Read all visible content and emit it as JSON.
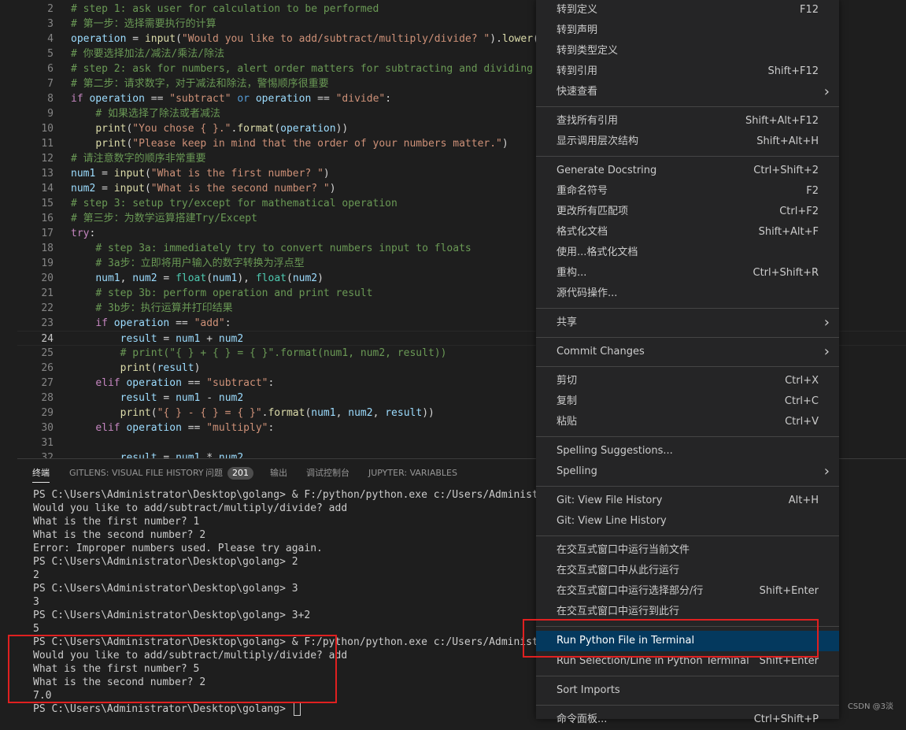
{
  "editor": {
    "lines": [
      {
        "num": "2",
        "tokens": [
          [
            "c",
            "# step 1: ask user for calculation to be performed"
          ]
        ]
      },
      {
        "num": "3",
        "tokens": [
          [
            "c",
            "# 第一步：选择需要执行的计算"
          ]
        ]
      },
      {
        "num": "4",
        "tokens": [
          [
            "v",
            "operation"
          ],
          [
            "o",
            " = "
          ],
          [
            "f",
            "input"
          ],
          [
            "o",
            "("
          ],
          [
            "s",
            "\"Would you like to add/subtract/multiply/divide? \""
          ],
          [
            "o",
            ")."
          ],
          [
            "f",
            "lower"
          ],
          [
            "o",
            "()"
          ]
        ]
      },
      {
        "num": "5",
        "tokens": [
          [
            "c",
            "# 你要选择加法/减法/乘法/除法"
          ]
        ]
      },
      {
        "num": "6",
        "tokens": [
          [
            "c",
            "# step 2: ask for numbers, alert order matters for subtracting and dividing"
          ]
        ]
      },
      {
        "num": "7",
        "tokens": [
          [
            "c",
            "# 第二步：请求数字，对于减法和除法，警惕顺序很重要"
          ]
        ]
      },
      {
        "num": "8",
        "tokens": [
          [
            "k",
            "if"
          ],
          [
            "o",
            " "
          ],
          [
            "v",
            "operation"
          ],
          [
            "o",
            " == "
          ],
          [
            "s",
            "\"subtract\""
          ],
          [
            "o",
            " "
          ],
          [
            "kb",
            "or"
          ],
          [
            "o",
            " "
          ],
          [
            "v",
            "operation"
          ],
          [
            "o",
            " == "
          ],
          [
            "s",
            "\"divide\""
          ],
          [
            "o",
            ":"
          ]
        ]
      },
      {
        "num": "9",
        "tokens": [
          [
            "o",
            "    "
          ],
          [
            "c",
            "# 如果选择了除法或者减法"
          ]
        ]
      },
      {
        "num": "10",
        "tokens": [
          [
            "o",
            "    "
          ],
          [
            "f",
            "print"
          ],
          [
            "o",
            "("
          ],
          [
            "s",
            "\"You chose { }.\""
          ],
          [
            "o",
            "."
          ],
          [
            "f",
            "format"
          ],
          [
            "o",
            "("
          ],
          [
            "v",
            "operation"
          ],
          [
            "o",
            "))"
          ]
        ]
      },
      {
        "num": "11",
        "tokens": [
          [
            "o",
            "    "
          ],
          [
            "f",
            "print"
          ],
          [
            "o",
            "("
          ],
          [
            "s",
            "\"Please keep in mind that the order of your numbers matter.\""
          ],
          [
            "o",
            ")"
          ]
        ]
      },
      {
        "num": "12",
        "tokens": [
          [
            "c",
            "# 请注意数字的顺序非常重要"
          ]
        ]
      },
      {
        "num": "13",
        "tokens": [
          [
            "v",
            "num1"
          ],
          [
            "o",
            " = "
          ],
          [
            "f",
            "input"
          ],
          [
            "o",
            "("
          ],
          [
            "s",
            "\"What is the first number? \""
          ],
          [
            "o",
            ")"
          ]
        ]
      },
      {
        "num": "14",
        "tokens": [
          [
            "v",
            "num2"
          ],
          [
            "o",
            " = "
          ],
          [
            "f",
            "input"
          ],
          [
            "o",
            "("
          ],
          [
            "s",
            "\"What is the second number? \""
          ],
          [
            "o",
            ")"
          ]
        ]
      },
      {
        "num": "15",
        "tokens": [
          [
            "c",
            "# step 3: setup try/except for mathematical operation"
          ]
        ]
      },
      {
        "num": "16",
        "tokens": [
          [
            "c",
            "# 第三步：为数学运算搭建Try/Except"
          ]
        ]
      },
      {
        "num": "17",
        "tokens": [
          [
            "k",
            "try"
          ],
          [
            "o",
            ":"
          ]
        ]
      },
      {
        "num": "18",
        "tokens": [
          [
            "o",
            "    "
          ],
          [
            "c",
            "# step 3a: immediately try to convert numbers input to floats"
          ]
        ]
      },
      {
        "num": "19",
        "tokens": [
          [
            "o",
            "    "
          ],
          [
            "c",
            "# 3a步：立即将用户输入的数字转换为浮点型"
          ]
        ]
      },
      {
        "num": "20",
        "tokens": [
          [
            "o",
            "    "
          ],
          [
            "v",
            "num1"
          ],
          [
            "o",
            ", "
          ],
          [
            "v",
            "num2"
          ],
          [
            "o",
            " = "
          ],
          [
            "n",
            "float"
          ],
          [
            "o",
            "("
          ],
          [
            "v",
            "num1"
          ],
          [
            "o",
            "), "
          ],
          [
            "n",
            "float"
          ],
          [
            "o",
            "("
          ],
          [
            "v",
            "num2"
          ],
          [
            "o",
            ")"
          ]
        ]
      },
      {
        "num": "21",
        "tokens": [
          [
            "o",
            "    "
          ],
          [
            "c",
            "# step 3b: perform operation and print result"
          ]
        ]
      },
      {
        "num": "22",
        "tokens": [
          [
            "o",
            "    "
          ],
          [
            "c",
            "# 3b步：执行运算并打印结果"
          ]
        ]
      },
      {
        "num": "23",
        "tokens": [
          [
            "o",
            "    "
          ],
          [
            "k",
            "if"
          ],
          [
            "o",
            " "
          ],
          [
            "v",
            "operation"
          ],
          [
            "o",
            " == "
          ],
          [
            "s",
            "\"add\""
          ],
          [
            "o",
            ":"
          ]
        ]
      },
      {
        "num": "24",
        "tokens": [
          [
            "o",
            "        "
          ],
          [
            "v",
            "result"
          ],
          [
            "o",
            " = "
          ],
          [
            "v",
            "num1"
          ],
          [
            "o",
            " + "
          ],
          [
            "v",
            "num2"
          ]
        ]
      },
      {
        "num": "25",
        "tokens": [
          [
            "o",
            "        "
          ],
          [
            "c",
            "# print(\"{ } + { } = { }\".format(num1, num2, result))"
          ]
        ]
      },
      {
        "num": "26",
        "tokens": [
          [
            "o",
            "        "
          ],
          [
            "f",
            "print"
          ],
          [
            "o",
            "("
          ],
          [
            "v",
            "result"
          ],
          [
            "o",
            ")"
          ]
        ]
      },
      {
        "num": "27",
        "tokens": [
          [
            "o",
            "    "
          ],
          [
            "k",
            "elif"
          ],
          [
            "o",
            " "
          ],
          [
            "v",
            "operation"
          ],
          [
            "o",
            " == "
          ],
          [
            "s",
            "\"subtract\""
          ],
          [
            "o",
            ":"
          ]
        ]
      },
      {
        "num": "28",
        "tokens": [
          [
            "o",
            "        "
          ],
          [
            "v",
            "result"
          ],
          [
            "o",
            " = "
          ],
          [
            "v",
            "num1"
          ],
          [
            "o",
            " - "
          ],
          [
            "v",
            "num2"
          ]
        ]
      },
      {
        "num": "29",
        "tokens": [
          [
            "o",
            "        "
          ],
          [
            "f",
            "print"
          ],
          [
            "o",
            "("
          ],
          [
            "s",
            "\"{ } - { } = { }\""
          ],
          [
            "o",
            "."
          ],
          [
            "f",
            "format"
          ],
          [
            "o",
            "("
          ],
          [
            "v",
            "num1"
          ],
          [
            "o",
            ", "
          ],
          [
            "v",
            "num2"
          ],
          [
            "o",
            ", "
          ],
          [
            "v",
            "result"
          ],
          [
            "o",
            "))"
          ]
        ]
      },
      {
        "num": "30",
        "tokens": [
          [
            "o",
            "    "
          ],
          [
            "k",
            "elif"
          ],
          [
            "o",
            " "
          ],
          [
            "v",
            "operation"
          ],
          [
            "o",
            " == "
          ],
          [
            "s",
            "\"multiply\""
          ],
          [
            "o",
            ":"
          ]
        ]
      },
      {
        "num": "31",
        "tokens": [
          [
            "o",
            ""
          ]
        ]
      },
      {
        "num": "32",
        "tokens": [
          [
            "o",
            "        "
          ],
          [
            "v",
            "result"
          ],
          [
            "o",
            " = "
          ],
          [
            "v",
            "num1"
          ],
          [
            "o",
            " * "
          ],
          [
            "v",
            "num2"
          ]
        ]
      }
    ]
  },
  "panel": {
    "tabs": [
      {
        "label": "终端",
        "active": true
      },
      {
        "label": "GITLENS: VISUAL FILE HISTORY"
      },
      {
        "label": "问题",
        "badge": "201"
      },
      {
        "label": "输出"
      },
      {
        "label": "调试控制台"
      },
      {
        "label": "JUPYTER: VARIABLES"
      }
    ],
    "terminal_lines": [
      "PS C:\\Users\\Administrator\\Desktop\\golang> & F:/python/python.exe c:/Users/Administrator/Desk",
      "Would you like to add/subtract/multiply/divide? add",
      "What is the first number? 1",
      "What is the second number? 2",
      "Error: Improper numbers used. Please try again.",
      "PS C:\\Users\\Administrator\\Desktop\\golang> 2",
      "2",
      "PS C:\\Users\\Administrator\\Desktop\\golang> 3",
      "3",
      "PS C:\\Users\\Administrator\\Desktop\\golang> 3+2",
      "5",
      "PS C:\\Users\\Administrator\\Desktop\\golang> & F:/python/python.exe c:/Users/Administrator/Desk",
      "Would you like to add/subtract/multiply/divide? add",
      "What is the first number? 5",
      "What is the second number? 2",
      "7.0",
      "PS C:\\Users\\Administrator\\Desktop\\golang> "
    ]
  },
  "context_menu": {
    "items": [
      {
        "label": "转到定义",
        "key": "F12"
      },
      {
        "label": "转到声明"
      },
      {
        "label": "转到类型定义"
      },
      {
        "label": "转到引用",
        "key": "Shift+F12"
      },
      {
        "label": "快速查看",
        "submenu": true
      },
      {
        "sep": true
      },
      {
        "label": "查找所有引用",
        "key": "Shift+Alt+F12"
      },
      {
        "label": "显示调用层次结构",
        "key": "Shift+Alt+H"
      },
      {
        "sep": true
      },
      {
        "label": "Generate Docstring",
        "key": "Ctrl+Shift+2"
      },
      {
        "label": "重命名符号",
        "key": "F2"
      },
      {
        "label": "更改所有匹配项",
        "key": "Ctrl+F2"
      },
      {
        "label": "格式化文档",
        "key": "Shift+Alt+F"
      },
      {
        "label": "使用...格式化文档"
      },
      {
        "label": "重构...",
        "key": "Ctrl+Shift+R"
      },
      {
        "label": "源代码操作..."
      },
      {
        "sep": true
      },
      {
        "label": "共享",
        "submenu": true
      },
      {
        "sep": true
      },
      {
        "label": "Commit Changes",
        "submenu": true
      },
      {
        "sep": true
      },
      {
        "label": "剪切",
        "key": "Ctrl+X"
      },
      {
        "label": "复制",
        "key": "Ctrl+C"
      },
      {
        "label": "粘贴",
        "key": "Ctrl+V"
      },
      {
        "sep": true
      },
      {
        "label": "Spelling Suggestions..."
      },
      {
        "label": "Spelling",
        "submenu": true
      },
      {
        "sep": true
      },
      {
        "label": "Git: View File History",
        "key": "Alt+H"
      },
      {
        "label": "Git: View Line History"
      },
      {
        "sep": true
      },
      {
        "label": "在交互式窗口中运行当前文件"
      },
      {
        "label": "在交互式窗口中从此行运行"
      },
      {
        "label": "在交互式窗口中运行选择部分/行",
        "key": "Shift+Enter"
      },
      {
        "label": "在交互式窗口中运行到此行"
      },
      {
        "sep": true
      },
      {
        "label": "Run Python File in Terminal",
        "active": true
      },
      {
        "label": "Run Selection/Line in Python Terminal",
        "key": "Shift+Enter"
      },
      {
        "sep": true
      },
      {
        "label": "Sort Imports"
      },
      {
        "sep": true
      },
      {
        "label": "命令面板...",
        "key": "Ctrl+Shift+P"
      }
    ]
  },
  "watermark": "CSDN @3淡"
}
